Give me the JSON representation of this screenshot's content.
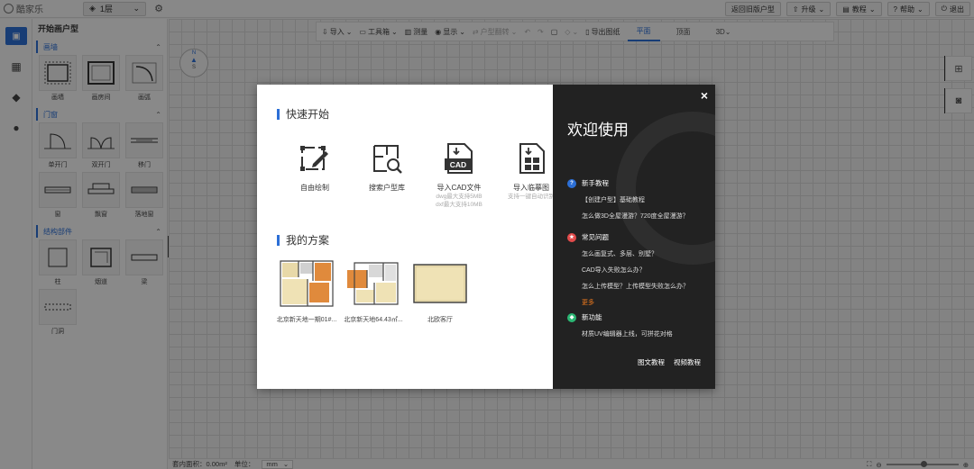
{
  "topbar": {
    "logo_text": "酷家乐",
    "floor": "1层",
    "buttons": [
      {
        "icon": "return-icon",
        "label": "返回旧版户型"
      },
      {
        "icon": "upgrade-icon",
        "label": "升级"
      },
      {
        "icon": "tutorial-icon",
        "label": "教程"
      },
      {
        "icon": "help-icon",
        "label": "帮助"
      },
      {
        "icon": "logout-icon",
        "label": "退出"
      }
    ]
  },
  "panel": {
    "title": "开始画户型",
    "sections": [
      {
        "title": "画墙",
        "items": [
          "画墙",
          "画房间",
          "画弧"
        ]
      },
      {
        "title": "门窗",
        "items": [
          "单开门",
          "双开门",
          "移门",
          "窗",
          "飘窗",
          "落地窗"
        ]
      },
      {
        "title": "结构部件",
        "items": [
          "柱",
          "烟道",
          "梁",
          "门洞"
        ]
      }
    ]
  },
  "toolbar": {
    "tools": [
      {
        "label": "导入",
        "disabled": false
      },
      {
        "label": "工具箱",
        "disabled": false
      },
      {
        "label": "测量",
        "disabled": false
      },
      {
        "label": "显示",
        "disabled": false
      },
      {
        "label": "户型翻转",
        "disabled": true
      },
      {
        "label": "导出图纸",
        "disabled": false
      }
    ],
    "views": [
      "平面",
      "顶面",
      "3D"
    ],
    "active_view": "平面"
  },
  "compass": {
    "north": "N",
    "south": "S"
  },
  "status": {
    "area_label": "套内面积：0.00m²",
    "unit_label": "单位：",
    "unit_value": "mm"
  },
  "modal": {
    "quick_start_title": "快速开始",
    "actions": [
      {
        "icon": "draw-icon",
        "label": "自由绘制",
        "sub": ""
      },
      {
        "icon": "search-floorplan-icon",
        "label": "搜索户型库",
        "sub": ""
      },
      {
        "icon": "cad-icon",
        "label": "导入CAD文件",
        "sub": "dwg最大支持5MB\ndxf最大支持10MB"
      },
      {
        "icon": "sketch-icon",
        "label": "导入临摹图",
        "sub": "支持一键自动识别"
      }
    ],
    "my_plans_title": "我的方案",
    "plans": [
      {
        "label": "北京新天地一期01#..."
      },
      {
        "label": "北京新天地64.43㎡..."
      },
      {
        "label": "北欧客厅"
      }
    ],
    "welcome": "欢迎使用",
    "close": "×",
    "groups": [
      {
        "icon_color": "#2c6fd6",
        "icon": "?",
        "title": "新手教程",
        "links": [
          "【创建户型】基础教程",
          "怎么做3D全屋漫游？720度全屋漫游？"
        ],
        "more": ""
      },
      {
        "icon_color": "#e24b4b",
        "icon": "★",
        "title": "常见问题",
        "links": [
          "怎么画复式、多层、别墅？",
          "CAD导入失败怎么办？",
          "怎么上传模型？上传模型失败怎么办？"
        ],
        "more": "更多"
      },
      {
        "icon_color": "#2bb673",
        "icon": "◆",
        "title": "新功能",
        "links": [
          "材质UV编辑器上线，可拼花对格"
        ],
        "more": ""
      }
    ],
    "bottom_links": [
      "图文教程",
      "视频教程"
    ]
  }
}
